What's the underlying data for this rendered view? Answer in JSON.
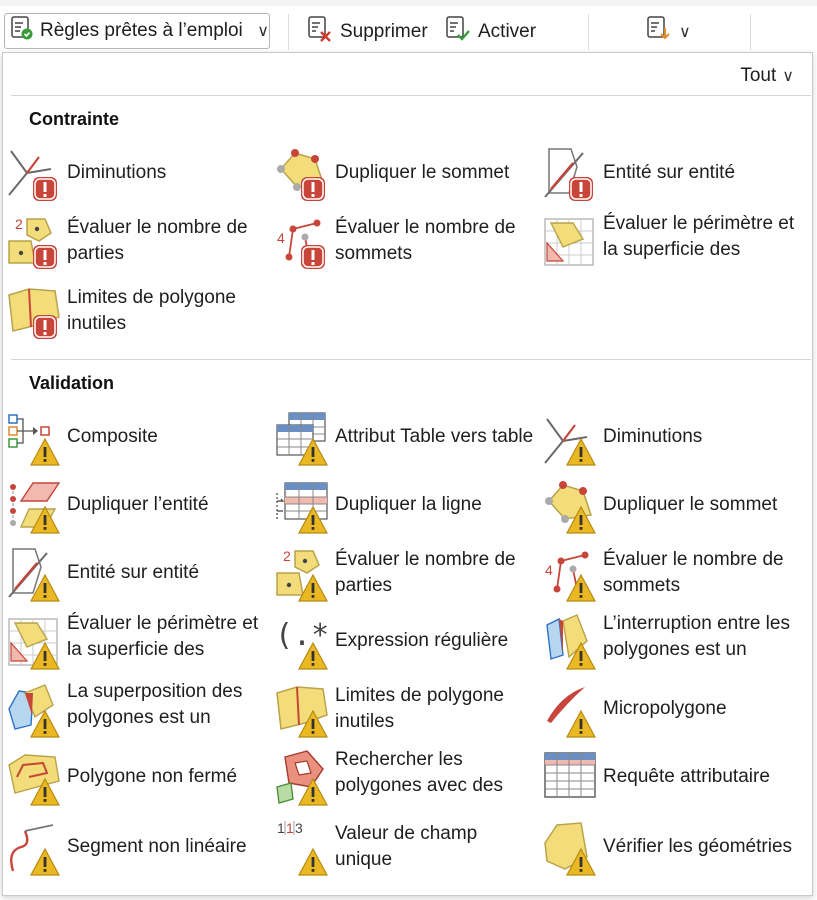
{
  "toolbar": {
    "rules_label": "Règles prêtes à l’emploi",
    "delete_label": "Supprimer",
    "activate_label": "Activer"
  },
  "panel": {
    "filter_label": "Tout",
    "constraint": {
      "title": "Contrainte",
      "items": [
        {
          "label": "Diminutions",
          "icon": "spike-icon"
        },
        {
          "label": "Dupliquer le sommet",
          "icon": "duplicate-vertex-icon"
        },
        {
          "label": "Entité sur entité",
          "icon": "feature-on-feature-icon"
        },
        {
          "label": "Évaluer le nombre de parties",
          "icon": "part-count-icon"
        },
        {
          "label": "Évaluer le nombre de sommets",
          "icon": "vertex-count-icon"
        },
        {
          "label": "Évaluer le périmètre et la superficie des polygones",
          "icon": "perimeter-area-icon"
        },
        {
          "label": "Limites de polygone inutiles",
          "icon": "unnecessary-boundary-icon"
        }
      ]
    },
    "validation": {
      "title": "Validation",
      "items": [
        {
          "label": "Composite",
          "icon": "composite-icon"
        },
        {
          "label": "Attribut Table vers table",
          "icon": "table-to-table-icon"
        },
        {
          "label": "Diminutions",
          "icon": "spike-icon"
        },
        {
          "label": "Dupliquer l’entité",
          "icon": "duplicate-feature-icon"
        },
        {
          "label": "Dupliquer la ligne",
          "icon": "duplicate-row-icon"
        },
        {
          "label": "Dupliquer le sommet",
          "icon": "duplicate-vertex-icon"
        },
        {
          "label": "Entité sur entité",
          "icon": "feature-on-feature-icon"
        },
        {
          "label": "Évaluer le nombre de parties",
          "icon": "part-count-icon"
        },
        {
          "label": "Évaluer le nombre de sommets",
          "icon": "vertex-count-icon"
        },
        {
          "label": "Évaluer le périmètre et la superficie des polygones",
          "icon": "perimeter-area-icon"
        },
        {
          "label": "Expression régulière",
          "icon": "regex-icon"
        },
        {
          "label": "L’interruption entre les polygones est un micropolygone",
          "icon": "polygon-gap-icon"
        },
        {
          "label": "La superposition des polygones est un micropolygone",
          "icon": "polygon-overlap-icon"
        },
        {
          "label": "Limites de polygone inutiles",
          "icon": "unnecessary-boundary-icon"
        },
        {
          "label": "Micropolygone",
          "icon": "sliver-icon"
        },
        {
          "label": "Polygone non fermé",
          "icon": "unclosed-polygon-icon"
        },
        {
          "label": "Rechercher les polygones avec des trous",
          "icon": "polygon-holes-icon"
        },
        {
          "label": "Requête attributaire",
          "icon": "attribute-query-icon"
        },
        {
          "label": "Segment non linéaire",
          "icon": "nonlinear-segment-icon"
        },
        {
          "label": "Valeur de champ unique",
          "icon": "unique-field-icon"
        },
        {
          "label": "Vérifier les géométries",
          "icon": "check-geometry-icon"
        }
      ]
    }
  },
  "colors": {
    "error": "#c8453a",
    "warning": "#e9b823",
    "polygon_fill": "#f3dd7a",
    "vertex": "#c8453a"
  }
}
